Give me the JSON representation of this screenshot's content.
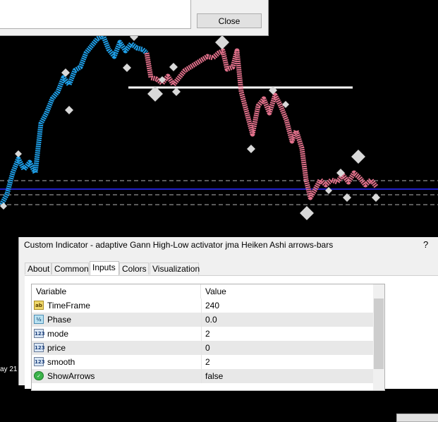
{
  "top_dialog": {
    "close_label": "Close"
  },
  "chart": {
    "date_label": "ay 21",
    "line_colors": {
      "up": "#1e9fe8",
      "down": "#e0708a",
      "level": "#ffffff",
      "blue_line": "#2020c8",
      "dashed": "#b4b4b4",
      "markers": "#d8d8d8"
    }
  },
  "dialog": {
    "title": "Custom Indicator - adaptive Gann High-Low activator jma Heiken Ashi arrows-bars",
    "help_label": "?",
    "tabs": [
      {
        "label": "About",
        "active": false
      },
      {
        "label": "Common",
        "active": false
      },
      {
        "label": "Inputs",
        "active": true
      },
      {
        "label": "Colors",
        "active": false
      },
      {
        "label": "Visualization",
        "active": false
      }
    ],
    "grid": {
      "header": {
        "variable": "Variable",
        "value": "Value"
      },
      "rows": [
        {
          "icon": "ab",
          "icon_name": "string-type-icon",
          "name": "TimeFrame",
          "value": "240"
        },
        {
          "icon": "½",
          "icon_name": "double-type-icon",
          "name": "Phase",
          "value": "0.0"
        },
        {
          "icon": "123",
          "icon_name": "integer-type-icon",
          "name": "mode",
          "value": "2"
        },
        {
          "icon": "123",
          "icon_name": "integer-type-icon",
          "name": "price",
          "value": "0"
        },
        {
          "icon": "123",
          "icon_name": "integer-type-icon",
          "name": "smooth",
          "value": "2"
        },
        {
          "icon": "✓",
          "icon_name": "bool-type-icon",
          "name": "ShowArrows",
          "value": "false"
        }
      ]
    }
  }
}
